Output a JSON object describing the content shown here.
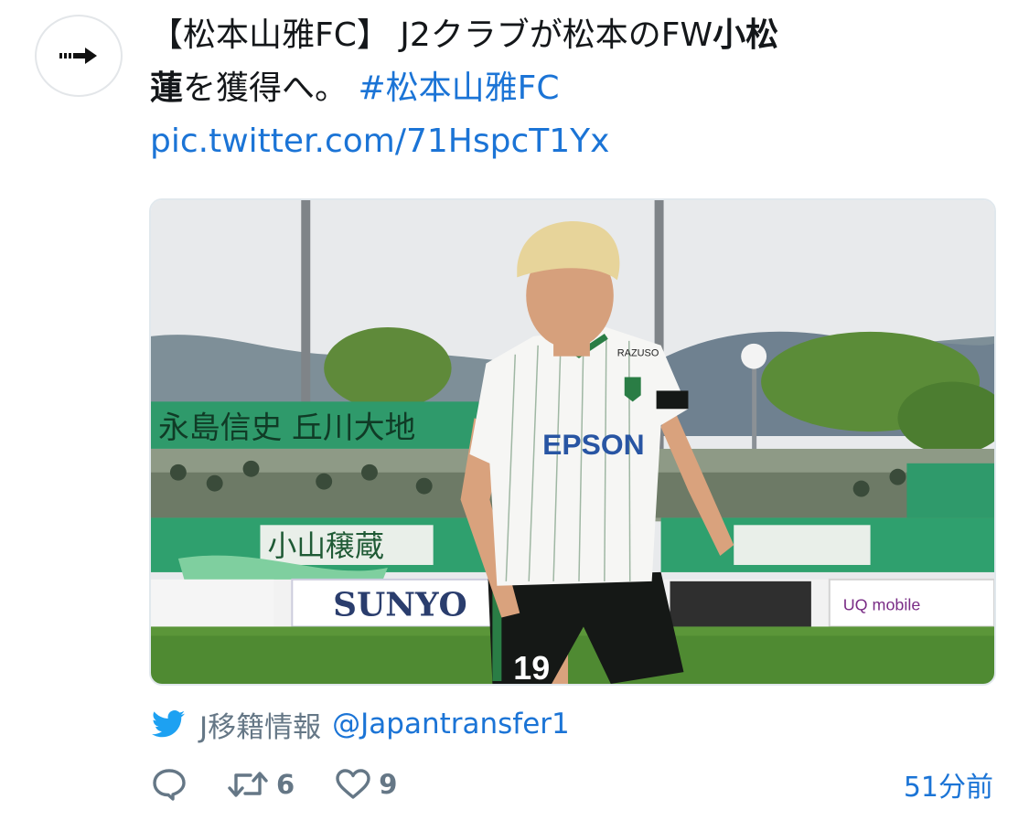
{
  "tweet": {
    "line1_plain": "【松本山雅FC】 J2クラブが松本のFW",
    "line1_bold": "小松",
    "line2_bold": "蓮",
    "line2_plain": "を獲得へ。 ",
    "hashtag": "#松本山雅FC",
    "pic_link": "pic.twitter.com/71HspcT1Yx"
  },
  "photo": {
    "jersey_sponsor": "EPSON",
    "jersey_brand": "RAZUSO",
    "shorts_number": "19",
    "banner_sunyo": "SUNYO",
    "banner_uq": "UQ mobile"
  },
  "source": {
    "icon": "twitter-bird-icon",
    "account_name": "J移籍情報",
    "handle": "@Japantransfer1"
  },
  "actions": {
    "reply_icon": "reply-icon",
    "retweet_icon": "retweet-icon",
    "retweet_count": "6",
    "like_icon": "heart-icon",
    "like_count": "9",
    "timestamp": "51分前"
  },
  "colors": {
    "link": "#1b74d6",
    "muted": "#657786",
    "bird": "#1da1f2"
  }
}
